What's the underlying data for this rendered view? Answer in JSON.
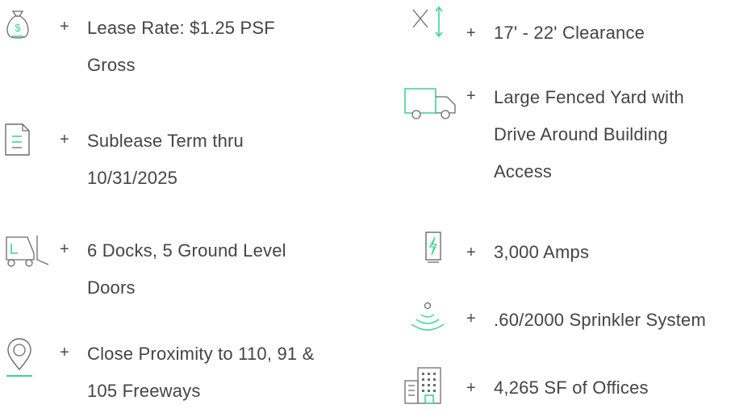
{
  "accent_color": "#3dd68c",
  "icon_color": "#6b6b6b",
  "features_left": [
    {
      "icon": "money-bag-icon",
      "plus": "+",
      "lines": [
        "Lease Rate: $1.25 PSF",
        "Gross"
      ]
    },
    {
      "icon": "document-icon",
      "plus": "+",
      "lines": [
        "Sublease Term thru",
        "10/31/2025"
      ]
    },
    {
      "icon": "forklift-icon",
      "plus": "+",
      "lines": [
        "6 Docks, 5 Ground Level",
        "Doors"
      ]
    },
    {
      "icon": "location-pin-icon",
      "plus": "+",
      "lines": [
        "Close Proximity to 110, 91 &",
        "105 Freeways"
      ]
    }
  ],
  "features_right": [
    {
      "icon": "clearance-height-icon",
      "plus": "+",
      "lines": [
        "17' - 22' Clearance"
      ]
    },
    {
      "icon": "truck-icon",
      "plus": "+",
      "lines": [
        "Large Fenced Yard with",
        "Drive Around Building",
        "Access"
      ]
    },
    {
      "icon": "power-battery-icon",
      "plus": "+",
      "lines": [
        "3,000 Amps"
      ]
    },
    {
      "icon": "sprinkler-icon",
      "plus": "+",
      "lines": [
        ".60/2000 Sprinkler System"
      ]
    },
    {
      "icon": "office-building-icon",
      "plus": "+",
      "lines": [
        "4,265 SF of Offices"
      ]
    }
  ]
}
